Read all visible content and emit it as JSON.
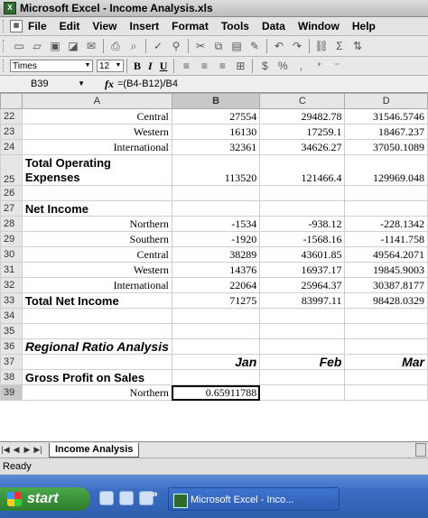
{
  "window": {
    "title": "Microsoft Excel - Income Analysis.xls"
  },
  "menu": [
    "File",
    "Edit",
    "View",
    "Insert",
    "Format",
    "Tools",
    "Data",
    "Window",
    "Help"
  ],
  "toolbar2": {
    "font": "Times",
    "size": "12"
  },
  "formula_bar": {
    "cell_ref": "B39",
    "fx": "fx",
    "formula": "=(B4-B12)/B4"
  },
  "columns": [
    "A",
    "B",
    "C",
    "D"
  ],
  "rows": [
    {
      "n": "22",
      "a": "Central",
      "b": "27554",
      "c": "29482.78",
      "d": "31546.5746"
    },
    {
      "n": "23",
      "a": "Western",
      "b": "16130",
      "c": "17259.1",
      "d": "18467.237"
    },
    {
      "n": "24",
      "a": "International",
      "b": "32361",
      "c": "34626.27",
      "d": "37050.1089"
    },
    {
      "n": "25",
      "a": "Total Operating Expenses",
      "b": "113520",
      "c": "121466.4",
      "d": "129969.048"
    },
    {
      "n": "26",
      "a": "",
      "b": "",
      "c": "",
      "d": ""
    },
    {
      "n": "27",
      "a": "Net Income",
      "b": "",
      "c": "",
      "d": ""
    },
    {
      "n": "28",
      "a": "Northern",
      "b": "-1534",
      "c": "-938.12",
      "d": "-228.1342"
    },
    {
      "n": "29",
      "a": "Southern",
      "b": "-1920",
      "c": "-1568.16",
      "d": "-1141.758"
    },
    {
      "n": "30",
      "a": "Central",
      "b": "38289",
      "c": "43601.85",
      "d": "49564.2071"
    },
    {
      "n": "31",
      "a": "Western",
      "b": "14376",
      "c": "16937.17",
      "d": "19845.9003"
    },
    {
      "n": "32",
      "a": "International",
      "b": "22064",
      "c": "25964.37",
      "d": "30387.8177"
    },
    {
      "n": "33",
      "a": "Total Net Income",
      "b": "71275",
      "c": "83997.11",
      "d": "98428.0329"
    },
    {
      "n": "34",
      "a": "",
      "b": "",
      "c": "",
      "d": ""
    },
    {
      "n": "35",
      "a": "",
      "b": "",
      "c": "",
      "d": ""
    },
    {
      "n": "36",
      "a": "Regional Ratio Analysis",
      "b": "",
      "c": "",
      "d": ""
    },
    {
      "n": "37",
      "a": "",
      "b": "Jan",
      "c": "Feb",
      "d": "Mar"
    },
    {
      "n": "38",
      "a": "Gross Profit on Sales",
      "b": "",
      "c": "",
      "d": ""
    },
    {
      "n": "39",
      "a": "Northern",
      "b": "0.65911788",
      "c": "",
      "d": ""
    }
  ],
  "sheet_tab": "Income Analysis",
  "status": "Ready",
  "taskbar": {
    "start": "start",
    "task": "Microsoft Excel - Inco..."
  }
}
